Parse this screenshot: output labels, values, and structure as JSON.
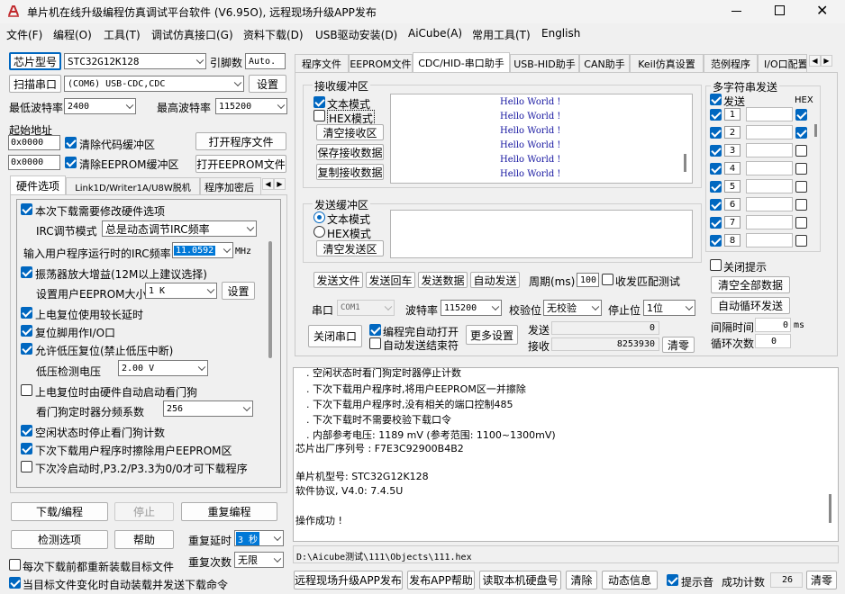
{
  "window": {
    "title": "单片机在线升级编程仿真调试平台软件 (V6.95O), 远程现场升级APP发布"
  },
  "menu": [
    "文件(F)",
    "编程(O)",
    "工具(T)",
    "调试仿真接口(G)",
    "资料下载(D)",
    "USB驱动安装(D)",
    "AiCube(A)",
    "常用工具(T)",
    "English"
  ],
  "left": {
    "chip_btn": "芯片型号",
    "chip_value": "STC32G12K128",
    "pin_label": "引脚数",
    "pin_value": "Auto.",
    "scan_btn": "扫描串口",
    "port_value": "(COM6) USB-CDC,CDC",
    "settings_btn": "设置",
    "min_baud_label": "最低波特率",
    "min_baud": "2400",
    "max_baud_label": "最高波特率",
    "max_baud": "115200",
    "start_addr_label": "起始地址",
    "addr1": "0x0000",
    "clear_code": "清除代码缓冲区",
    "open_prog": "打开程序文件",
    "addr2": "0x0000",
    "clear_eeprom": "清除EEPROM缓冲区",
    "open_eeprom": "打开EEPROM文件",
    "tabs": [
      "硬件选项",
      "Link1D/Writer1A/U8W脱机",
      "程序加密后"
    ],
    "opt_need_change": "本次下载需要修改硬件选项",
    "irc_mode_label": "IRC调节模式",
    "irc_mode": "总是动态调节IRC频率",
    "irc_freq_label": "输入用户程序运行时的IRC频率",
    "irc_freq": "11.0592",
    "irc_unit": "MHz",
    "osc_gain": "振荡器放大增益(12M以上建议选择)",
    "eeprom_size_label": "设置用户EEPROM大小",
    "eeprom_size": "1    K",
    "eeprom_set_btn": "设置",
    "poweron_delay": "上电复位使用较长延时",
    "reset_io": "复位脚用作I/O口",
    "lvd_reset": "允许低压复位(禁止低压中断)",
    "lvd_label": "低压检测电压",
    "lvd_value": "2.00 V",
    "wdt_auto": "上电复位时由硬件自动启动看门狗",
    "wdt_div_label": "看门狗定时器分频系数",
    "wdt_div": "256",
    "idle_wdt": "空闲状态时停止看门狗计数",
    "erase_eeprom": "下次下载用户程序时擦除用户EEPROM区",
    "p32_p33": "下次冷启动时,P3.2/P3.3为0/0才可下载程序",
    "download_btn": "下载/编程",
    "stop_btn": "停止",
    "reprog_btn": "重复编程",
    "check_btn": "检测选项",
    "help_btn": "帮助",
    "repeat_delay_label": "重复延时",
    "repeat_delay": "3 秒",
    "repeat_count_label": "重复次数",
    "repeat_count": "无限",
    "reload_each": "每次下载前都重新装载目标文件",
    "auto_reload": "当目标文件变化时自动装载并发送下载命令"
  },
  "right_tabs": [
    "程序文件",
    "EEPROM文件",
    "CDC/HID-串口助手",
    "USB-HID助手",
    "CAN助手",
    "Keil仿真设置",
    "范例程序",
    "I/O口配置"
  ],
  "serial": {
    "recv_title": "接收缓冲区",
    "text_mode": "文本模式",
    "hex_mode": "HEX模式",
    "clear_recv": "清空接收区",
    "save_recv": "保存接收数据",
    "copy_recv": "复制接收数据",
    "recv_lines": [
      "Hello World !",
      "Hello World !",
      "Hello World !",
      "Hello World !",
      "Hello World !",
      "Hello World !"
    ],
    "send_title": "发送缓冲区",
    "send_text_mode": "文本模式",
    "send_hex_mode": "HEX模式",
    "clear_send": "清空发送区",
    "send_file": "发送文件",
    "send_echo": "发送回车",
    "send_data": "发送数据",
    "auto_send": "自动发送",
    "period_label": "周期(ms)",
    "period": "100",
    "match_test": "收发匹配测试",
    "port_label": "串口",
    "port": "COM1",
    "baud_label": "波特率",
    "baud": "115200",
    "parity_label": "校验位",
    "parity": "无校验",
    "stop_label": "停止位",
    "stop": "1位",
    "close_port": "关闭串口",
    "auto_open": "编程完自动打开",
    "auto_send_end": "自动发送结束符",
    "more_settings": "更多设置",
    "send_count_label": "发送",
    "send_count": "0",
    "recv_count_label": "接收",
    "recv_count": "8253930",
    "clear_count": "清零"
  },
  "multi": {
    "title": "多字符串发送",
    "send_col": "发送",
    "hex_col": "HEX",
    "rows": [
      "1",
      "2",
      "3",
      "4",
      "5",
      "6",
      "7",
      "8"
    ],
    "close_hint": "关闭提示",
    "clear_all": "清空全部数据",
    "auto_loop": "自动循环发送",
    "interval_label": "间隔时间",
    "interval": "0",
    "interval_unit": "ms",
    "loop_label": "循环次数",
    "loop_count": "0"
  },
  "log": {
    "lines": [
      ". 空闲状态时看门狗定时器停止计数",
      ". 下次下载用户程序时,将用户EEPROM区一并擦除",
      ". 下次下载用户程序时,没有相关的端口控制485",
      ". 下次下载时不需要校验下载口令",
      ". 内部参考电压: 1189 mV (参考范围: 1100~1300mV)",
      "芯片出厂序列号 : F7E3C92900B4B2",
      "",
      "  单片机型号: STC32G12K128",
      "  软件协议, V4.0: 7.4.5U",
      "",
      "",
      "操作成功 !"
    ],
    "path": "D:\\Aicube测试\\111\\Objects\\111.hex"
  },
  "bottom": {
    "remote_btn": "远程现场升级APP发布",
    "publish_help": "发布APP帮助",
    "read_disk": "读取本机硬盘号",
    "clear_btn": "清除",
    "dyn_info": "动态信息",
    "beep": "提示音",
    "success_label": "成功计数",
    "success_count": "26",
    "clear_zero": "清零"
  }
}
